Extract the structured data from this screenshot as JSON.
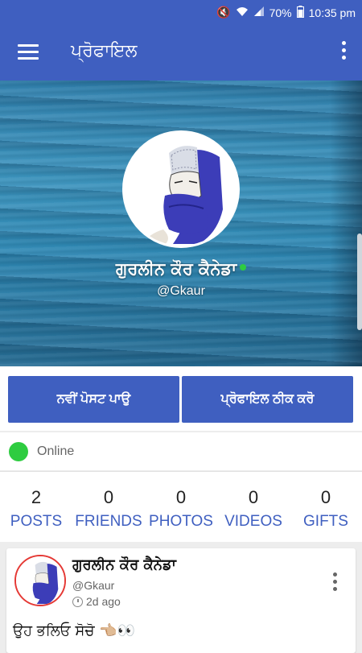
{
  "status_bar": {
    "battery": "70%",
    "time": "10:35 pm"
  },
  "app_bar": {
    "title": "ਪ੍ਰੋਫਾਇਲ"
  },
  "profile": {
    "name": "ਗੁਰਲੀਨ ਕੌਰ ਕੈਨੇਡਾ",
    "handle": "@Gkaur"
  },
  "actions": {
    "new_post": "ਨਵੀਂ ਪੋਸਟ ਪਾਉ",
    "edit_profile": "ਪ੍ਰੋਫਾਇਲ ਠੀਕ ਕਰੋ"
  },
  "online_status": "Online",
  "stats": [
    {
      "value": "2",
      "label": "POSTS"
    },
    {
      "value": "0",
      "label": "FRIENDS"
    },
    {
      "value": "0",
      "label": "PHOTOS"
    },
    {
      "value": "0",
      "label": "VIDEOS"
    },
    {
      "value": "0",
      "label": "GIFTS"
    }
  ],
  "post": {
    "author": "ਗੁਰਲੀਨ ਕੌਰ ਕੈਨੇਡਾ",
    "handle": "@Gkaur",
    "time": "2d ago",
    "text": "ਉਹ ਭਲਿਓ ਸੋਚੋ 👈🏼👀"
  },
  "colors": {
    "primary": "#3f5fc0",
    "online": "#2ecc40"
  }
}
